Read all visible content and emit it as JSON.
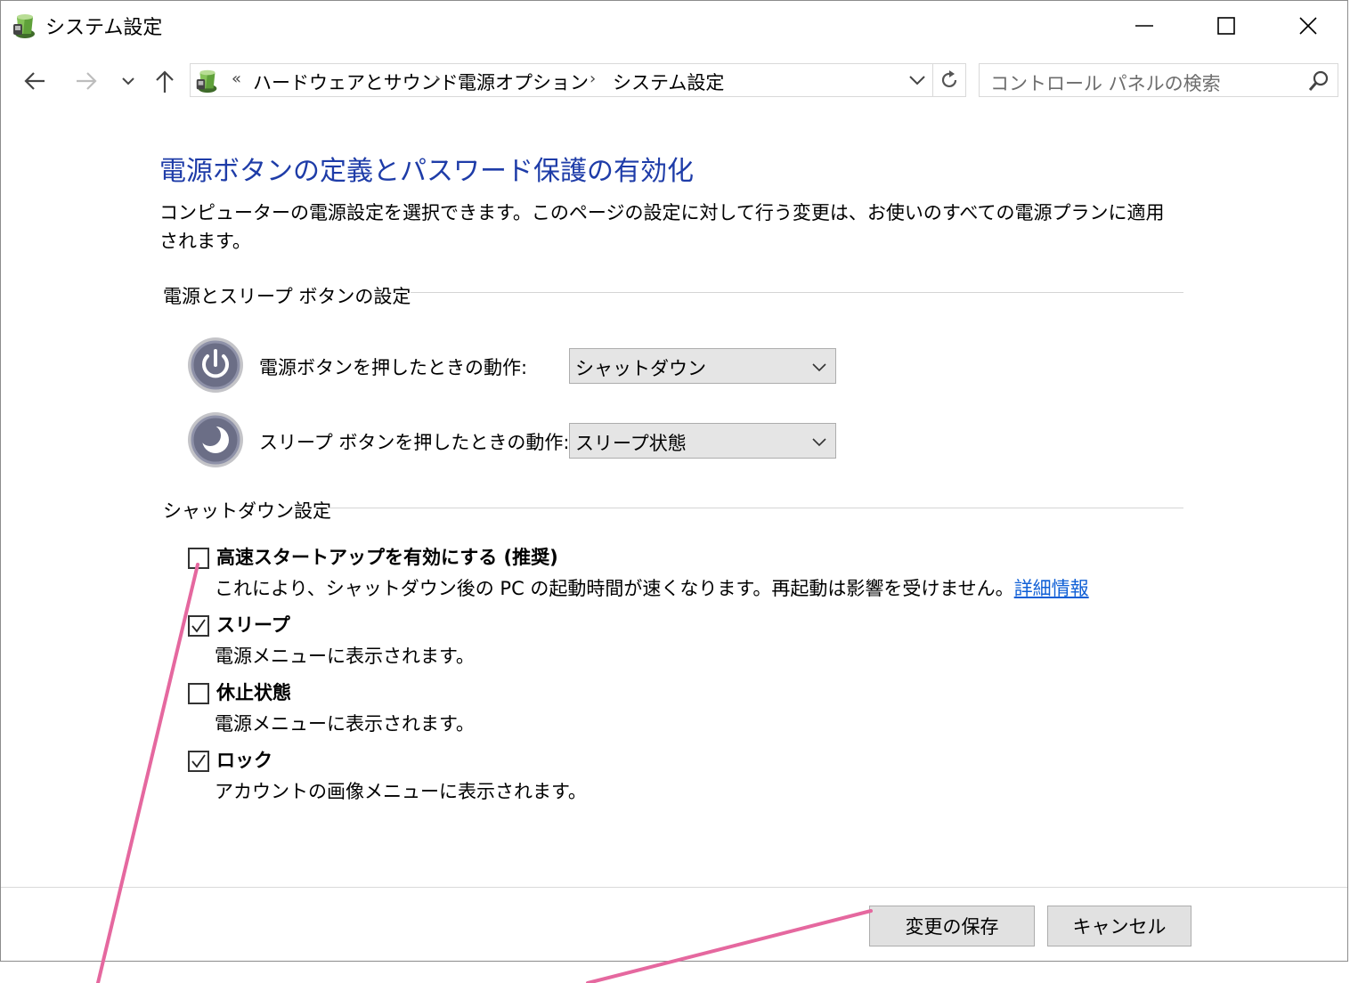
{
  "window": {
    "title": "システム設定"
  },
  "address": {
    "overflow": "«",
    "crumbs": [
      "ハードウェアとサウンド",
      "電源オプション",
      "システム設定"
    ],
    "separator": "›"
  },
  "search": {
    "placeholder": "コントロール パネルの検索"
  },
  "page": {
    "title": "電源ボタンの定義とパスワード保護の有効化",
    "description": "コンピューターの電源設定を選択できます。このページの設定に対して行う変更は、お使いのすべての電源プランに適用されます。"
  },
  "power_section": {
    "heading": "電源とスリープ ボタンの設定",
    "power_button": {
      "label": "電源ボタンを押したときの動作:",
      "value": "シャットダウン"
    },
    "sleep_button": {
      "label": "スリープ ボタンを押したときの動作:",
      "value": "スリープ状態"
    }
  },
  "shutdown_section": {
    "heading": "シャットダウン設定",
    "options": [
      {
        "label": "高速スタートアップを有効にする (推奨)",
        "desc": "これにより、シャットダウン後の PC の起動時間が速くなります。再起動は影響を受けません。",
        "link": "詳細情報",
        "checked": false
      },
      {
        "label": "スリープ",
        "desc": "電源メニューに表示されます。",
        "checked": true
      },
      {
        "label": "休止状態",
        "desc": "電源メニューに表示されます。",
        "checked": false
      },
      {
        "label": "ロック",
        "desc": "アカウントの画像メニューに表示されます。",
        "checked": true
      }
    ]
  },
  "buttons": {
    "save": "変更の保存",
    "cancel": "キャンセル"
  },
  "colors": {
    "title_blue": "#1e3ca8",
    "link_blue": "#0f5fd6",
    "annotation_pink": "#e5689f"
  }
}
